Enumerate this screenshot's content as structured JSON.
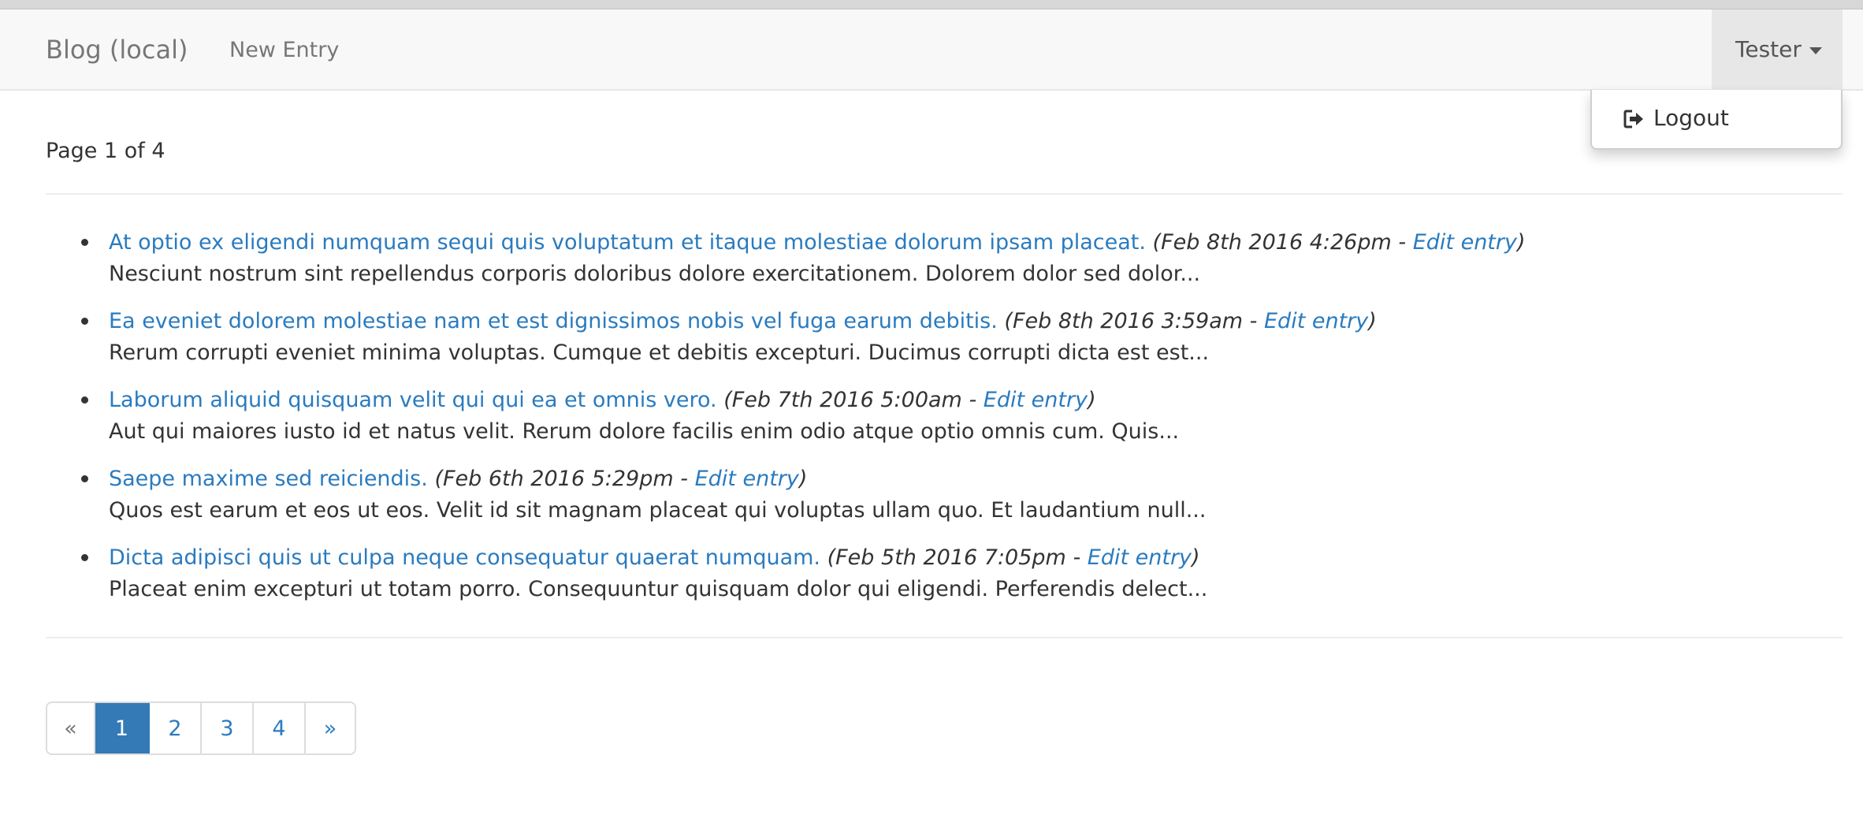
{
  "navbar": {
    "brand": "Blog (local)",
    "new_entry": "New Entry",
    "user": "Tester"
  },
  "user_menu": {
    "logout_label": "Logout",
    "logout_icon": "logout-icon"
  },
  "page_info": "Page 1 of 4",
  "entries": [
    {
      "title": "At optio ex eligendi numquam sequi quis voluptatum et itaque molestiae dolorum ipsam placeat.",
      "date": "Feb 8th 2016 4:26pm",
      "edit_label": "Edit entry",
      "excerpt": "Nesciunt nostrum sint repellendus corporis doloribus dolore exercitationem. Dolorem dolor sed dolor..."
    },
    {
      "title": "Ea eveniet dolorem molestiae nam et est dignissimos nobis vel fuga earum debitis.",
      "date": "Feb 8th 2016 3:59am",
      "edit_label": "Edit entry",
      "excerpt": "Rerum corrupti eveniet minima voluptas. Cumque et debitis excepturi. Ducimus corrupti dicta est est..."
    },
    {
      "title": "Laborum aliquid quisquam velit qui qui ea et omnis vero.",
      "date": "Feb 7th 2016 5:00am",
      "edit_label": "Edit entry",
      "excerpt": "Aut qui maiores iusto id et natus velit. Rerum dolore facilis enim odio atque optio omnis cum. Quis..."
    },
    {
      "title": "Saepe maxime sed reiciendis.",
      "date": "Feb 6th 2016 5:29pm",
      "edit_label": "Edit entry",
      "excerpt": "Quos est earum et eos ut eos. Velit id sit magnam placeat qui voluptas ullam quo. Et laudantium null..."
    },
    {
      "title": "Dicta adipisci quis ut culpa neque consequatur quaerat numquam.",
      "date": "Feb 5th 2016 7:05pm",
      "edit_label": "Edit entry",
      "excerpt": "Placeat enim excepturi ut totam porro. Consequuntur quisquam dolor qui eligendi. Perferendis delect..."
    }
  ],
  "pagination": {
    "prev": "«",
    "pages": [
      "1",
      "2",
      "3",
      "4"
    ],
    "next": "»",
    "active": "1"
  },
  "colors": {
    "link": "#2a7bbf",
    "active_page": "#337ab7",
    "navbar_bg": "#f8f8f8"
  }
}
